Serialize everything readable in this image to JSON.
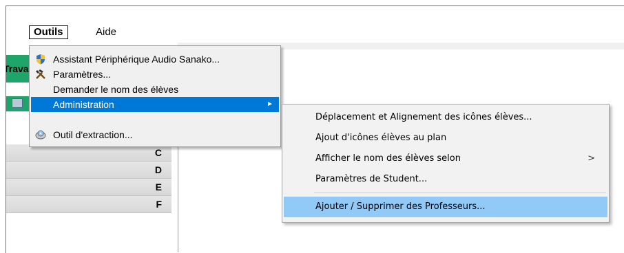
{
  "menubar": {
    "items": [
      {
        "label": "Outils"
      },
      {
        "label": "Aide"
      }
    ]
  },
  "left_panel": {
    "header_text": "Trava",
    "rows": [
      "C",
      "D",
      "E",
      "F"
    ]
  },
  "dropdown": {
    "items": [
      {
        "label": "Assistant Périphérique Audio Sanako...",
        "icon": "shield-icon"
      },
      {
        "label": "Paramètres...",
        "icon": "tools-icon"
      },
      {
        "label": "Demander le nom des élèves",
        "icon": ""
      },
      {
        "label": "Administration",
        "icon": "",
        "has_submenu": true,
        "arrow": "►"
      },
      {
        "label": "Outil d'extraction...",
        "icon": "disc-icon"
      }
    ],
    "selected_index": 3,
    "selected_color": "#0078d7"
  },
  "submenu": {
    "items": [
      {
        "label": "Déplacement et Alignement des icônes élèves..."
      },
      {
        "label": "Ajout d'icônes élèves au plan"
      },
      {
        "label": "Afficher le nom des élèves selon",
        "arrow": ">"
      },
      {
        "label": "Paramètres de Student..."
      },
      {
        "label": "Ajouter / Supprimer des Professeurs..."
      }
    ],
    "hot_index": 4,
    "hot_color": "#91c9f7"
  }
}
